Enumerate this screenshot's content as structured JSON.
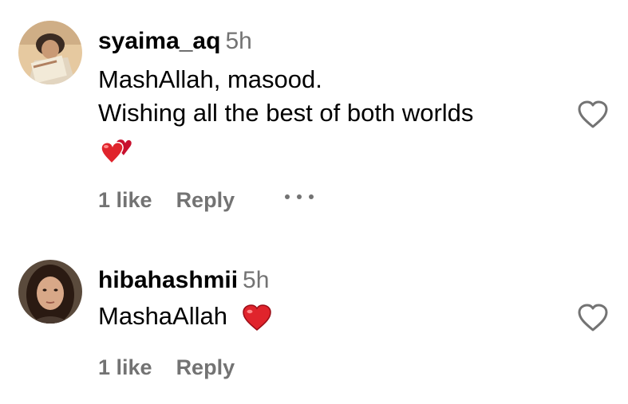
{
  "comments": [
    {
      "username": "syaima_aq",
      "time": "5h",
      "lines": [
        "MashAllah, masood.",
        "Wishing all the best of both worlds"
      ],
      "emoji": "two-hearts",
      "likes": "1 like",
      "reply": "Reply",
      "more_icon": "more-options-icon",
      "heart_icon": "heart-outline-icon"
    },
    {
      "username": "hibahashmii",
      "time": "5h",
      "text": "MashaAllah",
      "emoji": "red-heart",
      "likes": "1 like",
      "reply": "Reply",
      "heart_icon": "heart-outline-icon"
    }
  ],
  "colors": {
    "text": "#000000",
    "secondary": "#737373",
    "heart_red": "#e0242c",
    "background": "#ffffff"
  }
}
